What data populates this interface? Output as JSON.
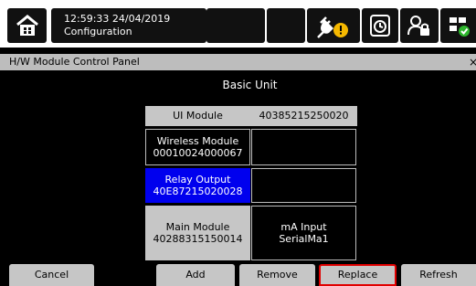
{
  "header": {
    "time_date": "12:59:33 24/04/2019",
    "screen_name": "Configuration"
  },
  "panel": {
    "title": "H/W Module Control Panel",
    "close_glyph": "×"
  },
  "section_title": "Basic Unit",
  "modules": {
    "ui_module": {
      "name": "UI Module",
      "serial": "40385215250020"
    },
    "wireless": {
      "name": "Wireless Module",
      "serial": "00010024000067"
    },
    "relay": {
      "name": "Relay Output",
      "serial": "40E87215020028"
    },
    "main": {
      "name": "Main Module",
      "serial": "40288315150014"
    },
    "ma_input": {
      "name": "mA Input",
      "serial": "SerialMa1"
    }
  },
  "buttons": {
    "cancel": "Cancel",
    "add": "Add",
    "remove": "Remove",
    "replace": "Replace",
    "refresh": "Refresh"
  },
  "icons": [
    "home-icon",
    "power-plug-alarm-icon",
    "clock-icon",
    "user-lock-icon",
    "network-icon"
  ],
  "colors": {
    "selected": "#0000ee",
    "highlight": "#e00000",
    "panel": "#bdbdbd",
    "button": "#c6c6c6"
  }
}
